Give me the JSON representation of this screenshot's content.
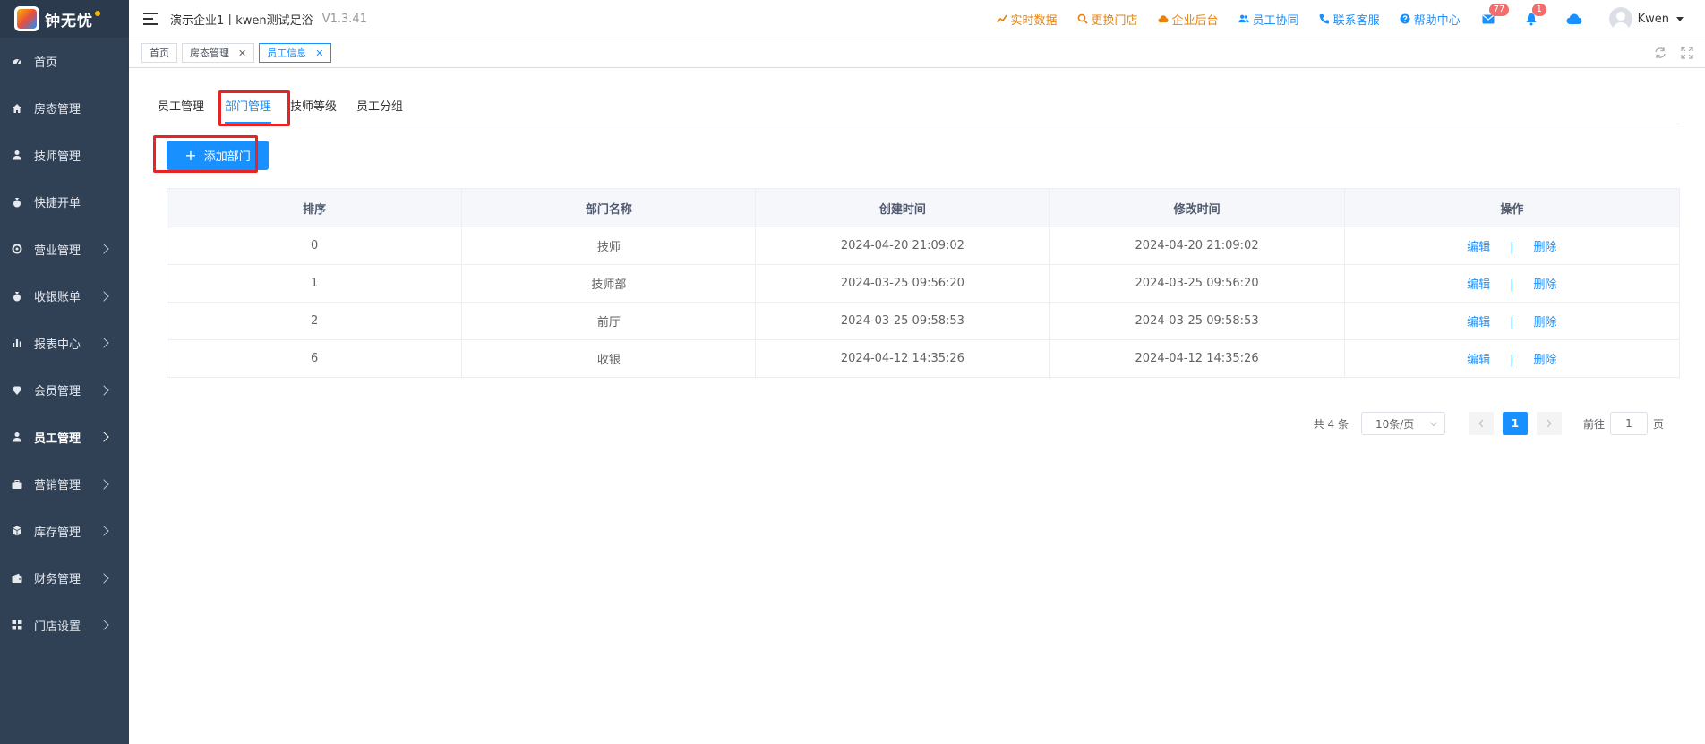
{
  "logo": {
    "text": "钟无忧"
  },
  "sidebar": {
    "items": [
      {
        "label": "首页",
        "icon": "dashboard-icon",
        "arrow": false,
        "active": false
      },
      {
        "label": "房态管理",
        "icon": "home-icon",
        "arrow": false,
        "active": false
      },
      {
        "label": "技师管理",
        "icon": "person-icon",
        "arrow": false,
        "active": false
      },
      {
        "label": "快捷开单",
        "icon": "money-bag-icon",
        "arrow": false,
        "active": false
      },
      {
        "label": "营业管理",
        "icon": "lifebuoy-icon",
        "arrow": true,
        "active": false
      },
      {
        "label": "收银账单",
        "icon": "money-bag-icon",
        "arrow": true,
        "active": false
      },
      {
        "label": "报表中心",
        "icon": "bar-chart-icon",
        "arrow": true,
        "active": false
      },
      {
        "label": "会员管理",
        "icon": "diamond-icon",
        "arrow": true,
        "active": false
      },
      {
        "label": "员工管理",
        "icon": "person-icon",
        "arrow": true,
        "active": true
      },
      {
        "label": "营销管理",
        "icon": "briefcase-icon",
        "arrow": true,
        "active": false
      },
      {
        "label": "库存管理",
        "icon": "box-icon",
        "arrow": true,
        "active": false
      },
      {
        "label": "财务管理",
        "icon": "wallet-icon",
        "arrow": true,
        "active": false
      },
      {
        "label": "门店设置",
        "icon": "grid-icon",
        "arrow": true,
        "active": false
      }
    ]
  },
  "header": {
    "title": "演示企业1丨kwen测试足浴",
    "version": "V1.3.41",
    "links": [
      {
        "label": "实时数据",
        "icon": "trend-icon",
        "color": "orange"
      },
      {
        "label": "更换门店",
        "icon": "search-icon",
        "color": "orange"
      },
      {
        "label": "企业后台",
        "icon": "cloud-icon",
        "color": "orange"
      },
      {
        "label": "员工协同",
        "icon": "users-icon",
        "color": "blue"
      },
      {
        "label": "联系客服",
        "icon": "phone-icon",
        "color": "blue"
      },
      {
        "label": "帮助中心",
        "icon": "help-icon",
        "color": "blue"
      }
    ],
    "mail_badge": "77",
    "bell_badge": "1",
    "user_name": "Kwen"
  },
  "tags": [
    {
      "label": "首页",
      "closable": false,
      "active": false
    },
    {
      "label": "房态管理",
      "closable": true,
      "active": false
    },
    {
      "label": "员工信息",
      "closable": true,
      "active": true
    }
  ],
  "tabs": [
    {
      "label": "员工管理",
      "active": false
    },
    {
      "label": "部门管理",
      "active": true
    },
    {
      "label": "技师等级",
      "active": false
    },
    {
      "label": "员工分组",
      "active": false
    }
  ],
  "add_button": "添加部门",
  "table": {
    "headers": [
      "排序",
      "部门名称",
      "创建时间",
      "修改时间",
      "操作"
    ],
    "rows": [
      {
        "order": "0",
        "name": "技师",
        "created": "2024-04-20 21:09:02",
        "modified": "2024-04-20 21:09:02"
      },
      {
        "order": "1",
        "name": "技师部",
        "created": "2024-03-25 09:56:20",
        "modified": "2024-03-25 09:56:20"
      },
      {
        "order": "2",
        "name": "前厅",
        "created": "2024-03-25 09:58:53",
        "modified": "2024-03-25 09:58:53"
      },
      {
        "order": "6",
        "name": "收银",
        "created": "2024-04-12 14:35:26",
        "modified": "2024-04-12 14:35:26"
      }
    ],
    "edit_label": "编辑",
    "separator": "|",
    "delete_label": "删除"
  },
  "pagination": {
    "total": "共 4 条",
    "page_size": "10条/页",
    "current_page": "1",
    "goto_label": "前往",
    "goto_value": "1",
    "page_unit": "页"
  },
  "colors": {
    "sidebar_bg": "#304156",
    "primary": "#1890ff",
    "orange": "#e6820e",
    "highlight": "#e52525"
  }
}
